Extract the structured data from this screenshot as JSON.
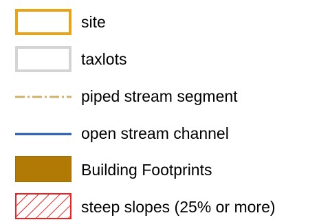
{
  "legend": {
    "items": [
      {
        "label": "site",
        "symbol": "outlined-box",
        "color": "#e8a317"
      },
      {
        "label": "taxlots",
        "symbol": "outlined-box",
        "color": "#d4d4d4"
      },
      {
        "label": "piped stream segment",
        "symbol": "dash-dot-line",
        "color": "#d2b06a"
      },
      {
        "label": "open stream channel",
        "symbol": "solid-line",
        "color": "#1f56a8"
      },
      {
        "label": "Building Footprints",
        "symbol": "filled-box",
        "color": "#b07a05"
      },
      {
        "label": "steep slopes (25% or more)",
        "symbol": "hatched-box",
        "color": "#ee2020"
      }
    ]
  }
}
